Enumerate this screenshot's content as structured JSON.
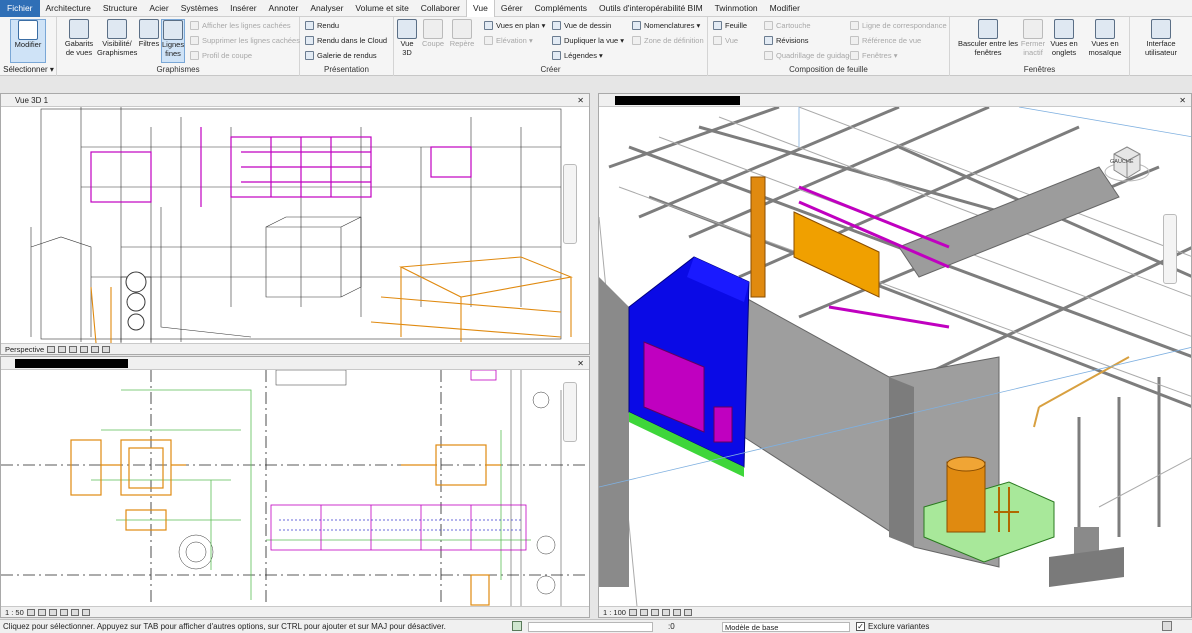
{
  "menu": {
    "tabs": [
      "Fichier",
      "Architecture",
      "Structure",
      "Acier",
      "Systèmes",
      "Insérer",
      "Annoter",
      "Analyser",
      "Volume et site",
      "Collaborer",
      "Vue",
      "Gérer",
      "Compléments",
      "Outils d'interopérabilité BIM",
      "Twinmotion",
      "Modifier"
    ],
    "active": "Vue"
  },
  "ribbon": {
    "select": {
      "modifier": "Modifier",
      "label": "Sélectionner ▾"
    },
    "graphismes": {
      "title": "Graphismes",
      "gabarits": "Gabarits de vues",
      "visibilite": "Visibilité/ Graphismes",
      "filtres": "Filtres",
      "lignes_fines": "Lignes fines",
      "afficher_lignes": "Afficher les lignes cachées",
      "supprimer_lignes": "Supprimer les lignes cachées",
      "profil_coupe": "Profil de coupe"
    },
    "presentation": {
      "title": "Présentation",
      "rendu": "Rendu",
      "rendu_cloud": "Rendu  dans le Cloud",
      "galerie": "Galerie  de rendus"
    },
    "creer": {
      "title": "Créer",
      "vue3d": "Vue 3D",
      "coupe": "Coupe",
      "repere": "Repère",
      "vues_plan": "Vues en plan",
      "elevation": "Elévation",
      "legendes": "Légendes",
      "vue_dessin": "Vue de dessin",
      "dupliquer": "Dupliquer la vue",
      "nomenclatures": "Nomenclatures",
      "zone_definition": "Zone de définition"
    },
    "composition": {
      "title": "Composition de feuille",
      "feuille": "Feuille",
      "vue": "Vue",
      "cartouche": "Cartouche",
      "revisions": "Révisions",
      "quadrillage": "Quadrillage de guidage",
      "ligne_corresp": "Ligne de correspondance",
      "reference_vue": "Référence de vue",
      "fenetres": "Fenêtres"
    },
    "fenetres": {
      "title": "Fenêtres",
      "basculer": "Basculer entre les fenêtres",
      "fermer": "Fermer inactif",
      "onglets": "Vues en onglets",
      "mosaique": "Vues en mosaïque",
      "interface": "Interface utilisateur"
    }
  },
  "views": {
    "v3d": {
      "title": "Vue 3D 1",
      "mode": "Perspective"
    },
    "plan": {
      "scale": "1 : 50"
    },
    "right": {
      "scale": "1 : 100",
      "viewcube": "GAUCHE"
    }
  },
  "status": {
    "message": "Cliquez pour sélectionner. Appuyez sur TAB pour afficher d'autres options, sur CTRL pour ajouter et sur MAJ pour désactiver.",
    "zero": ":0",
    "model": "Modèle de base",
    "exclude": "Exclure variantes"
  },
  "colors": {
    "blue": "#0000ee",
    "magenta": "#c000c0",
    "orange": "#e08a10",
    "green": "#7ed67a",
    "gray": "#9c9c9c"
  }
}
